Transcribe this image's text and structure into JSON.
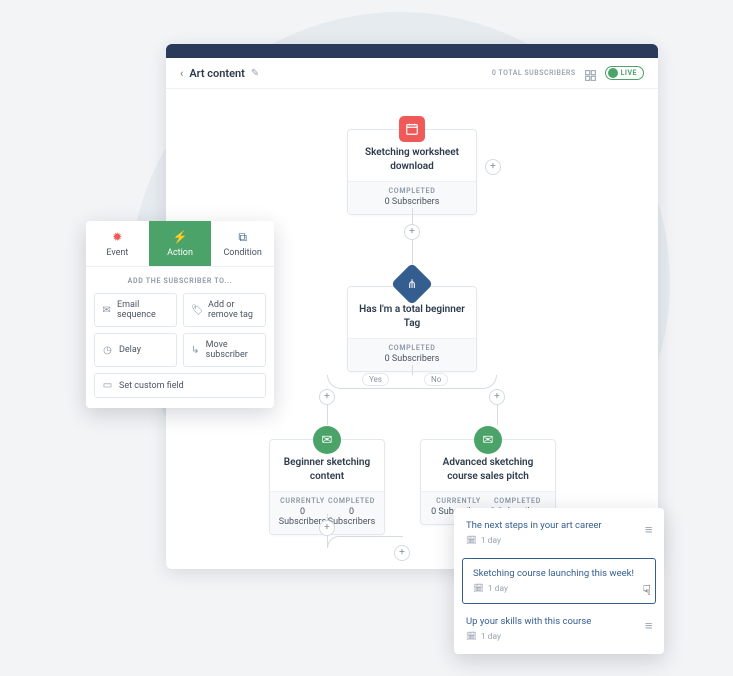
{
  "header": {
    "breadcrumb": "Art content",
    "subscribers_label": "0 TOTAL SUBSCRIBERS",
    "live_label": "LIVE"
  },
  "nodes": {
    "start": {
      "title": "Sketching worksheet download",
      "status": "COMPLETED",
      "subs": "0 Subscribers"
    },
    "cond": {
      "title": "Has I'm a total beginner Tag",
      "status": "COMPLETED",
      "subs": "0 Subscribers"
    },
    "branch": {
      "yes": "Yes",
      "no": "No"
    },
    "left": {
      "title": "Beginner sketching content",
      "col1_lab": "CURRENTLY",
      "col1_val": "0 Subscribers",
      "col2_lab": "COMPLETED",
      "col2_val": "0 Subscribers"
    },
    "right": {
      "title": "Advanced sketching course sales pitch",
      "col1_lab": "CURRENTLY",
      "col1_val": "0 Subscribers",
      "col2_lab": "COMPLETED",
      "col2_val": "0 Subscribers"
    }
  },
  "action_panel": {
    "tabs": {
      "event": "Event",
      "action": "Action",
      "condition": "Condition"
    },
    "section": "ADD THE SUBSCRIBER TO...",
    "options": {
      "email_seq": "Email sequence",
      "add_tag": "Add or remove tag",
      "delay": "Delay",
      "move_sub": "Move subscriber",
      "set_field": "Set custom field"
    }
  },
  "emails": {
    "row1": {
      "title": "The next steps in your art career",
      "meta": "1 day"
    },
    "row2": {
      "title": "Sketching course launching this week!",
      "meta": "1 day"
    },
    "row3": {
      "title": "Up your skills with this course",
      "meta": "1 day"
    }
  }
}
